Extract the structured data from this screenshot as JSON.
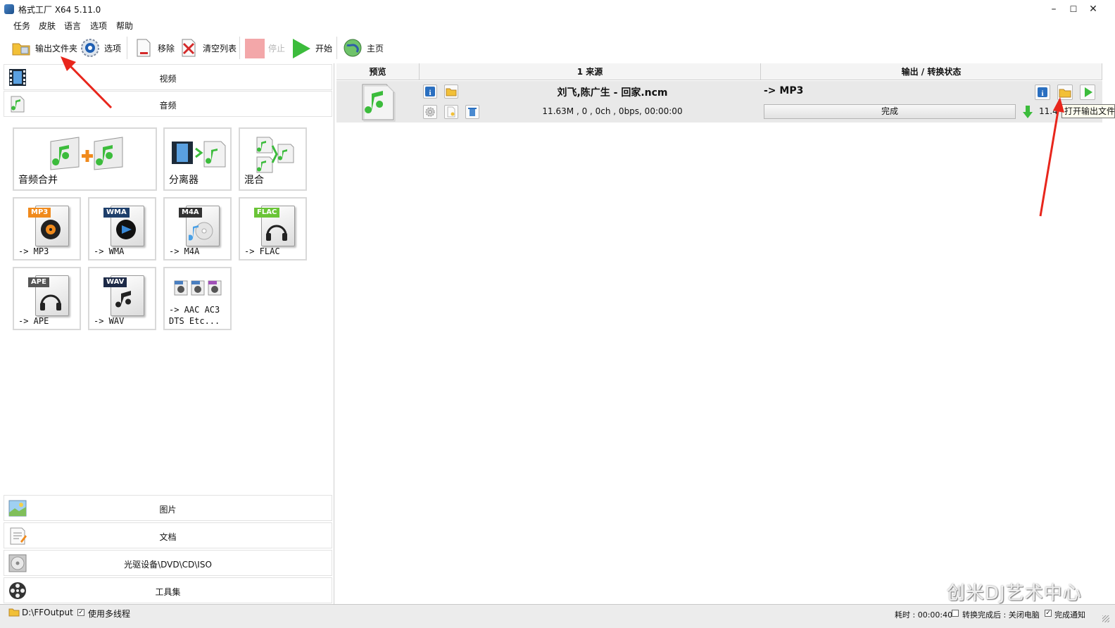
{
  "window": {
    "title": "格式工厂 X64 5.11.0",
    "minimize": "–",
    "maximize": "☐",
    "close": "✕"
  },
  "menu": [
    "任务",
    "皮肤",
    "语言",
    "选项",
    "帮助"
  ],
  "toolbar": {
    "output_folder": "输出文件夹",
    "options": "选项",
    "remove": "移除",
    "clear_list": "清空列表",
    "stop": "停止",
    "start": "开始",
    "home": "主页"
  },
  "categories": {
    "video": "视频",
    "audio": "音频",
    "picture": "图片",
    "document": "文档",
    "rom": "光驱设备\\DVD\\CD\\ISO",
    "tools": "工具集"
  },
  "audio_tiles": {
    "merge": "音频合并",
    "splitter": "分离器",
    "mix": "混合",
    "mp3": "-> MP3",
    "wma": "-> WMA",
    "m4a": "-> M4A",
    "flac": "-> FLAC",
    "ape": "-> APE",
    "wav": "-> WAV",
    "more_line1": "-> AAC AC3",
    "more_line2": "DTS Etc...",
    "badges": {
      "mp3": "MP3",
      "wma": "WMA",
      "m4a": "M4A",
      "flac": "FLAC",
      "ape": "APE",
      "wav": "WAV"
    }
  },
  "task_list": {
    "headers": {
      "preview": "预览",
      "source": "1 来源",
      "output": "输出 / 转换状态"
    },
    "task": {
      "filename": "刘飞,陈广生 - 回家.ncm",
      "info": "11.63M , 0 , 0ch , 0bps, 00:00:00",
      "target": "-> MP3",
      "status": "完成",
      "output_size": "11.4",
      "progress_fraction": 1.0
    }
  },
  "tooltip": "打开输出文件夹",
  "statusbar": {
    "output_path": "D:\\FFOutput",
    "multithread": "使用多线程",
    "elapsed": "耗时 : 00:00:40",
    "after_convert": "转换完成后 : 关闭电脑",
    "notify": "完成通知"
  },
  "watermark": "创米DJ艺术中心",
  "colors": {
    "accent_green": "#3cbc3c",
    "annotation_red": "#e8261c",
    "info_blue": "#2a6fc0",
    "folder_yellow": "#f2c037"
  }
}
